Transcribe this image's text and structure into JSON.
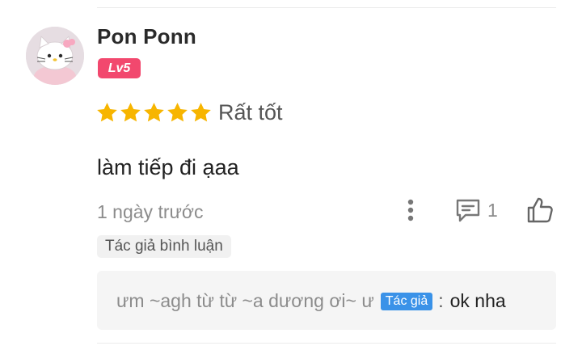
{
  "comment": {
    "username": "Pon Ponn",
    "level": "Lv5",
    "rating": {
      "stars": 5,
      "max": 5,
      "label": "Rất tốt"
    },
    "text": "làm tiếp đi ạaa",
    "timestamp": "1 ngày trước",
    "reply_count": "1",
    "author_tag": "Tác giả bình luận",
    "icons": {
      "avatar": "hello-kitty-avatar",
      "star": "star-icon",
      "more": "more-vertical-icon",
      "reply": "comment-icon",
      "like": "thumbs-up-icon"
    }
  },
  "reply": {
    "name": "ưm ~agh từ từ ~a dương ơi~ ư",
    "badge": "Tác giả",
    "separator": ":",
    "text": "ok nha"
  },
  "colors": {
    "level_badge": "#f2486e",
    "star": "#f7b500",
    "author_badge": "#3a92e8",
    "muted_text": "#8c8c8c"
  }
}
